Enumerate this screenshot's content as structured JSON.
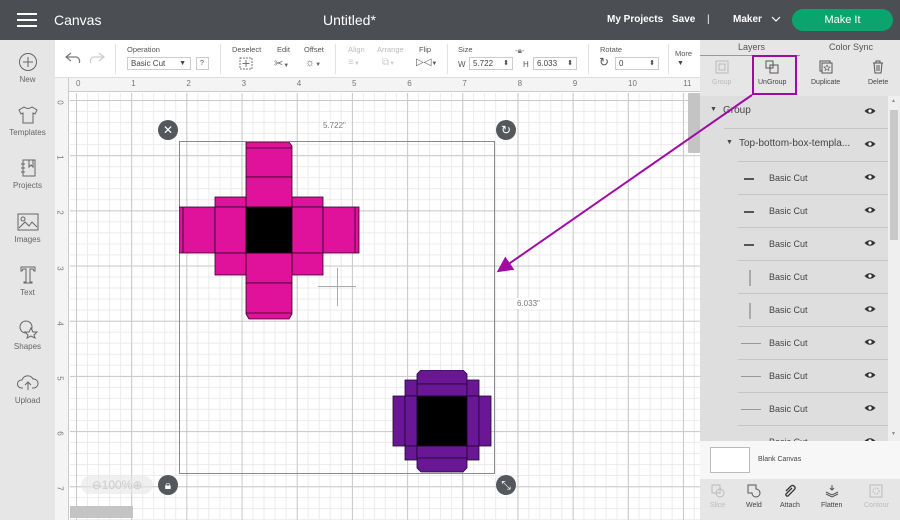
{
  "topbar": {
    "app_name": "Canvas",
    "doc_title": "Untitled*",
    "my_projects": "My Projects",
    "save": "Save",
    "divider": "|",
    "machine": "Maker",
    "make_it": "Make It"
  },
  "leftbar": {
    "items": [
      {
        "label": "New",
        "icon": "plus-circle-icon"
      },
      {
        "label": "Templates",
        "icon": "tshirt-icon"
      },
      {
        "label": "Projects",
        "icon": "notebook-icon"
      },
      {
        "label": "Images",
        "icon": "image-icon"
      },
      {
        "label": "Text",
        "icon": "text-icon"
      },
      {
        "label": "Shapes",
        "icon": "shapes-icon"
      },
      {
        "label": "Upload",
        "icon": "upload-cloud-icon"
      }
    ]
  },
  "toolbar": {
    "operation_label": "Operation",
    "operation_value": "Basic Cut",
    "help": "?",
    "deselect": "Deselect",
    "edit": "Edit",
    "offset": "Offset",
    "align": "Align",
    "arrange": "Arrange",
    "flip": "Flip",
    "size_label": "Size",
    "w_label": "W",
    "w_value": "5.722",
    "h_label": "H",
    "h_value": "6.033",
    "rotate_label": "Rotate",
    "rotate_value": "0",
    "more": "More"
  },
  "canvas": {
    "ruler_top": [
      "0",
      "1",
      "2",
      "3",
      "4",
      "5",
      "6",
      "7",
      "8",
      "9",
      "10",
      "11"
    ],
    "ruler_left": [
      "0",
      "1",
      "2",
      "3",
      "4",
      "5",
      "6",
      "7"
    ],
    "width_dim": "5.722\"",
    "height_dim": "6.033\"",
    "zoom": "100%",
    "colors": {
      "pink": "#e0119a",
      "purple": "#6a1796",
      "center": "#000000",
      "annotation": "#a20aa6"
    }
  },
  "rightpanel": {
    "tabs": [
      "Layers",
      "Color Sync"
    ],
    "tools": [
      {
        "label": "Group",
        "disabled": true
      },
      {
        "label": "UnGroup",
        "disabled": false
      },
      {
        "label": "Duplicate",
        "disabled": false
      },
      {
        "label": "Delete",
        "disabled": false
      }
    ],
    "layers": [
      {
        "name": "Group",
        "level": 0,
        "type": "group"
      },
      {
        "name": "Top-bottom-box-templa...",
        "level": 1,
        "type": "group"
      },
      {
        "name": "Basic Cut",
        "level": 2,
        "type": "h-short"
      },
      {
        "name": "Basic Cut",
        "level": 2,
        "type": "h-short"
      },
      {
        "name": "Basic Cut",
        "level": 2,
        "type": "h-short"
      },
      {
        "name": "Basic Cut",
        "level": 2,
        "type": "vertical"
      },
      {
        "name": "Basic Cut",
        "level": 2,
        "type": "vertical"
      },
      {
        "name": "Basic Cut",
        "level": 2,
        "type": "h-long"
      },
      {
        "name": "Basic Cut",
        "level": 2,
        "type": "h-long"
      },
      {
        "name": "Basic Cut",
        "level": 2,
        "type": "h-long"
      },
      {
        "name": "Basic Cut",
        "level": 2,
        "type": "h-long"
      }
    ],
    "blank_canvas": "Blank Canvas",
    "bottom_tools": [
      {
        "label": "Slice",
        "disabled": true
      },
      {
        "label": "Weld",
        "disabled": false
      },
      {
        "label": "Attach",
        "disabled": false
      },
      {
        "label": "Flatten",
        "disabled": false
      },
      {
        "label": "Contour",
        "disabled": true
      }
    ]
  }
}
